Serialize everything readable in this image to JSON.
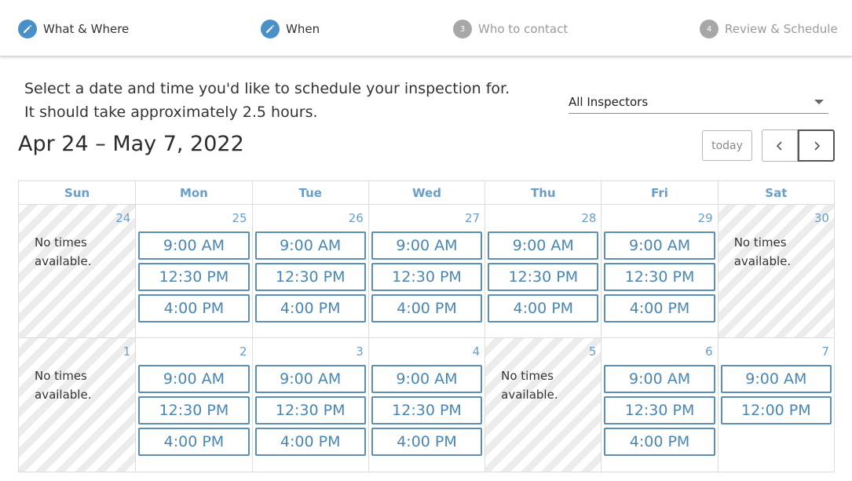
{
  "steps": [
    {
      "label": "What & Where",
      "icon": "pencil-icon",
      "state": "done"
    },
    {
      "label": "When",
      "icon": "pencil-icon",
      "state": "done"
    },
    {
      "label": "Who to contact",
      "number": "3",
      "state": "pending"
    },
    {
      "label": "Review & Schedule",
      "number": "4",
      "state": "pending"
    }
  ],
  "intro": {
    "line1": "Select a date and time you'd like to schedule your inspection for.",
    "line2": "It should take approximately 2.5 hours."
  },
  "inspector_select": {
    "value": "All Inspectors"
  },
  "calendar": {
    "range_title": "Apr 24 – May 7, 2022",
    "today_label": "today",
    "prev_icon": "chevron-left-icon",
    "next_icon": "chevron-right-icon",
    "days_of_week": [
      "Sun",
      "Mon",
      "Tue",
      "Wed",
      "Thu",
      "Fri",
      "Sat"
    ],
    "no_times_text": "No times available.",
    "weeks": [
      [
        {
          "num": "24",
          "slots": []
        },
        {
          "num": "25",
          "slots": [
            "9:00 AM",
            "12:30 PM",
            "4:00 PM"
          ]
        },
        {
          "num": "26",
          "slots": [
            "9:00 AM",
            "12:30 PM",
            "4:00 PM"
          ]
        },
        {
          "num": "27",
          "slots": [
            "9:00 AM",
            "12:30 PM",
            "4:00 PM"
          ]
        },
        {
          "num": "28",
          "slots": [
            "9:00 AM",
            "12:30 PM",
            "4:00 PM"
          ]
        },
        {
          "num": "29",
          "slots": [
            "9:00 AM",
            "12:30 PM",
            "4:00 PM"
          ]
        },
        {
          "num": "30",
          "slots": []
        }
      ],
      [
        {
          "num": "1",
          "slots": []
        },
        {
          "num": "2",
          "slots": [
            "9:00 AM",
            "12:30 PM",
            "4:00 PM"
          ]
        },
        {
          "num": "3",
          "slots": [
            "9:00 AM",
            "12:30 PM",
            "4:00 PM"
          ]
        },
        {
          "num": "4",
          "slots": [
            "9:00 AM",
            "12:30 PM",
            "4:00 PM"
          ]
        },
        {
          "num": "5",
          "slots": []
        },
        {
          "num": "6",
          "slots": [
            "9:00 AM",
            "12:30 PM",
            "4:00 PM"
          ]
        },
        {
          "num": "7",
          "slots": [
            "9:00 AM",
            "12:00 PM"
          ],
          "striped": false
        }
      ]
    ]
  },
  "colors": {
    "accent": "#4a90c8",
    "slot_border": "#5b8fb6",
    "day_header": "#6a9ec9",
    "pending_step": "#a7a7a7"
  }
}
